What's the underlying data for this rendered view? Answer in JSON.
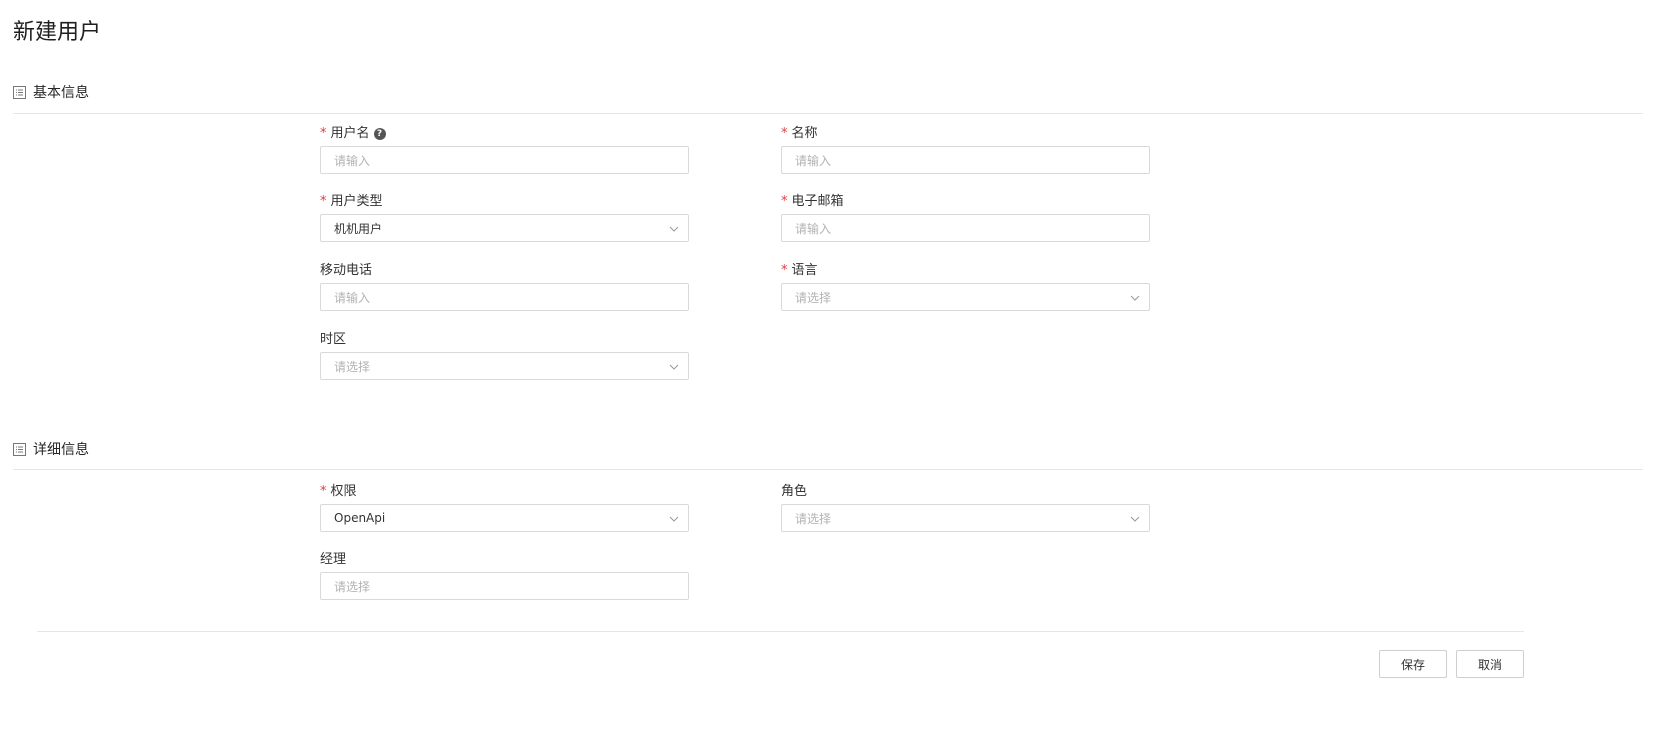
{
  "page": {
    "title": "新建用户"
  },
  "sections": {
    "basic": {
      "title": "基本信息"
    },
    "detail": {
      "title": "详细信息"
    }
  },
  "fields": {
    "username": {
      "label": "用户名",
      "required": true,
      "placeholder": "请输入"
    },
    "name": {
      "label": "名称",
      "required": true,
      "placeholder": "请输入"
    },
    "user_type": {
      "label": "用户类型",
      "required": true,
      "value": "机机用户"
    },
    "email": {
      "label": "电子邮箱",
      "required": true,
      "placeholder": "请输入"
    },
    "mobile": {
      "label": "移动电话",
      "required": false,
      "placeholder": "请输入"
    },
    "language": {
      "label": "语言",
      "required": true,
      "placeholder": "请选择"
    },
    "timezone": {
      "label": "时区",
      "required": false,
      "placeholder": "请选择"
    },
    "permission": {
      "label": "权限",
      "required": true,
      "value": "OpenApi"
    },
    "role": {
      "label": "角色",
      "required": false,
      "placeholder": "请选择"
    },
    "manager": {
      "label": "经理",
      "required": false,
      "placeholder": "请选择"
    }
  },
  "required_marker": "*",
  "help_glyph": "?",
  "actions": {
    "save": "保存",
    "cancel": "取消"
  },
  "colors": {
    "required": "#e4393c",
    "border": "#d9d9d9",
    "placeholder": "#b3b3b3"
  }
}
